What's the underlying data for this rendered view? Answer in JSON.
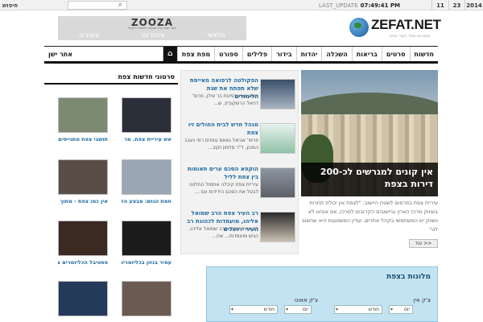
{
  "topbar": {
    "search_label": "חיפוש",
    "search_icon": "search-icon",
    "last_update_label": "LAST_UPDATE",
    "last_update_time": "07:49:41 PM",
    "date": {
      "day": "11",
      "month": "23",
      "year": "2014"
    }
  },
  "ad": {
    "brand": "ZOOZA",
    "tagline": "אתר שבו הכל אפשרי לשלוח ולקבל",
    "items": [
      "עיצובים",
      "אינטרנט",
      "פלאשי"
    ]
  },
  "logo": {
    "name": "ZEFAT.NET",
    "sub": "צפת.נט אתר העיר צפת"
  },
  "nav": {
    "items": [
      "חדשות",
      "סרטים",
      "בריאות",
      "השכלה",
      "יהדות",
      "בידור",
      "פלילים",
      "ספורט",
      "מפת צפת"
    ],
    "old_site": "אתר ישן"
  },
  "featured": {
    "caption": "אין קונים למגרשים לכ-200 דירות בצפת",
    "text": "עיריית צפת בפרסום לשטח היישוב: \"לצפת אין יכולת תחרות בשיווק מרכז הארץ וביישובים הקרובים למרכז, אם אנחנו לא נשווק יש המשתמשי בקהל אחרים, ועדין המשמעות היא שחשוב לנו\"",
    "more": "עוד >>"
  },
  "news": [
    {
      "title": "הפקולטה לרפואה מאיימת שלא תפתח את שנת הלימודים",
      "body": "נשיא אוניברסיטת בר אילן, פרופ' דניאל הרשקוביץ, ש..."
    },
    {
      "title": "מנהל חדש לבית החולים זיו צפת",
      "body": "פרופ' אביאל גאאס גופנים רמי נעבב המכון, ד\"ר סלמון וקוב..."
    },
    {
      "title": "הוקפא הסכם ערים תאומות בין צפת לליל",
      "body": "עיריית צפת קיבלה אתמול החלטה לבטל את הסכם הידידות עם ..."
    },
    {
      "title": "רב העיר צפת הרב שמואל אליהו, מועמדות לכהונת רב העיר ירושלים",
      "body": "רב העיר צפת, הרב שמואל אליהו, הגיש מועמדות... אח..."
    }
  ],
  "videos": {
    "heading": "סרטוני חדשות צפת",
    "items": [
      "אש עיריית צפת. מר אילן...",
      "תושבי צפת מתגייסים לשמור את...",
      "חמת הגוש: מבצע הקפה בצפת...",
      "אין כמו צפת - מתוך התוכנית...",
      "עמיר בנזון בכליזמרים צפת 2013",
      "פסטיבל הכליזמרים צפת 2013",
      "",
      ""
    ]
  },
  "calendar": {
    "title": "מלונות בצפת",
    "checkin": "צ'ק אין",
    "checkout": "צ'ק אאוט",
    "day": "יום",
    "month": "חודש"
  },
  "colors": {
    "accent": "#1b6aa0",
    "nav_border": "#111111",
    "cal_bg": "#c3e3f3"
  }
}
